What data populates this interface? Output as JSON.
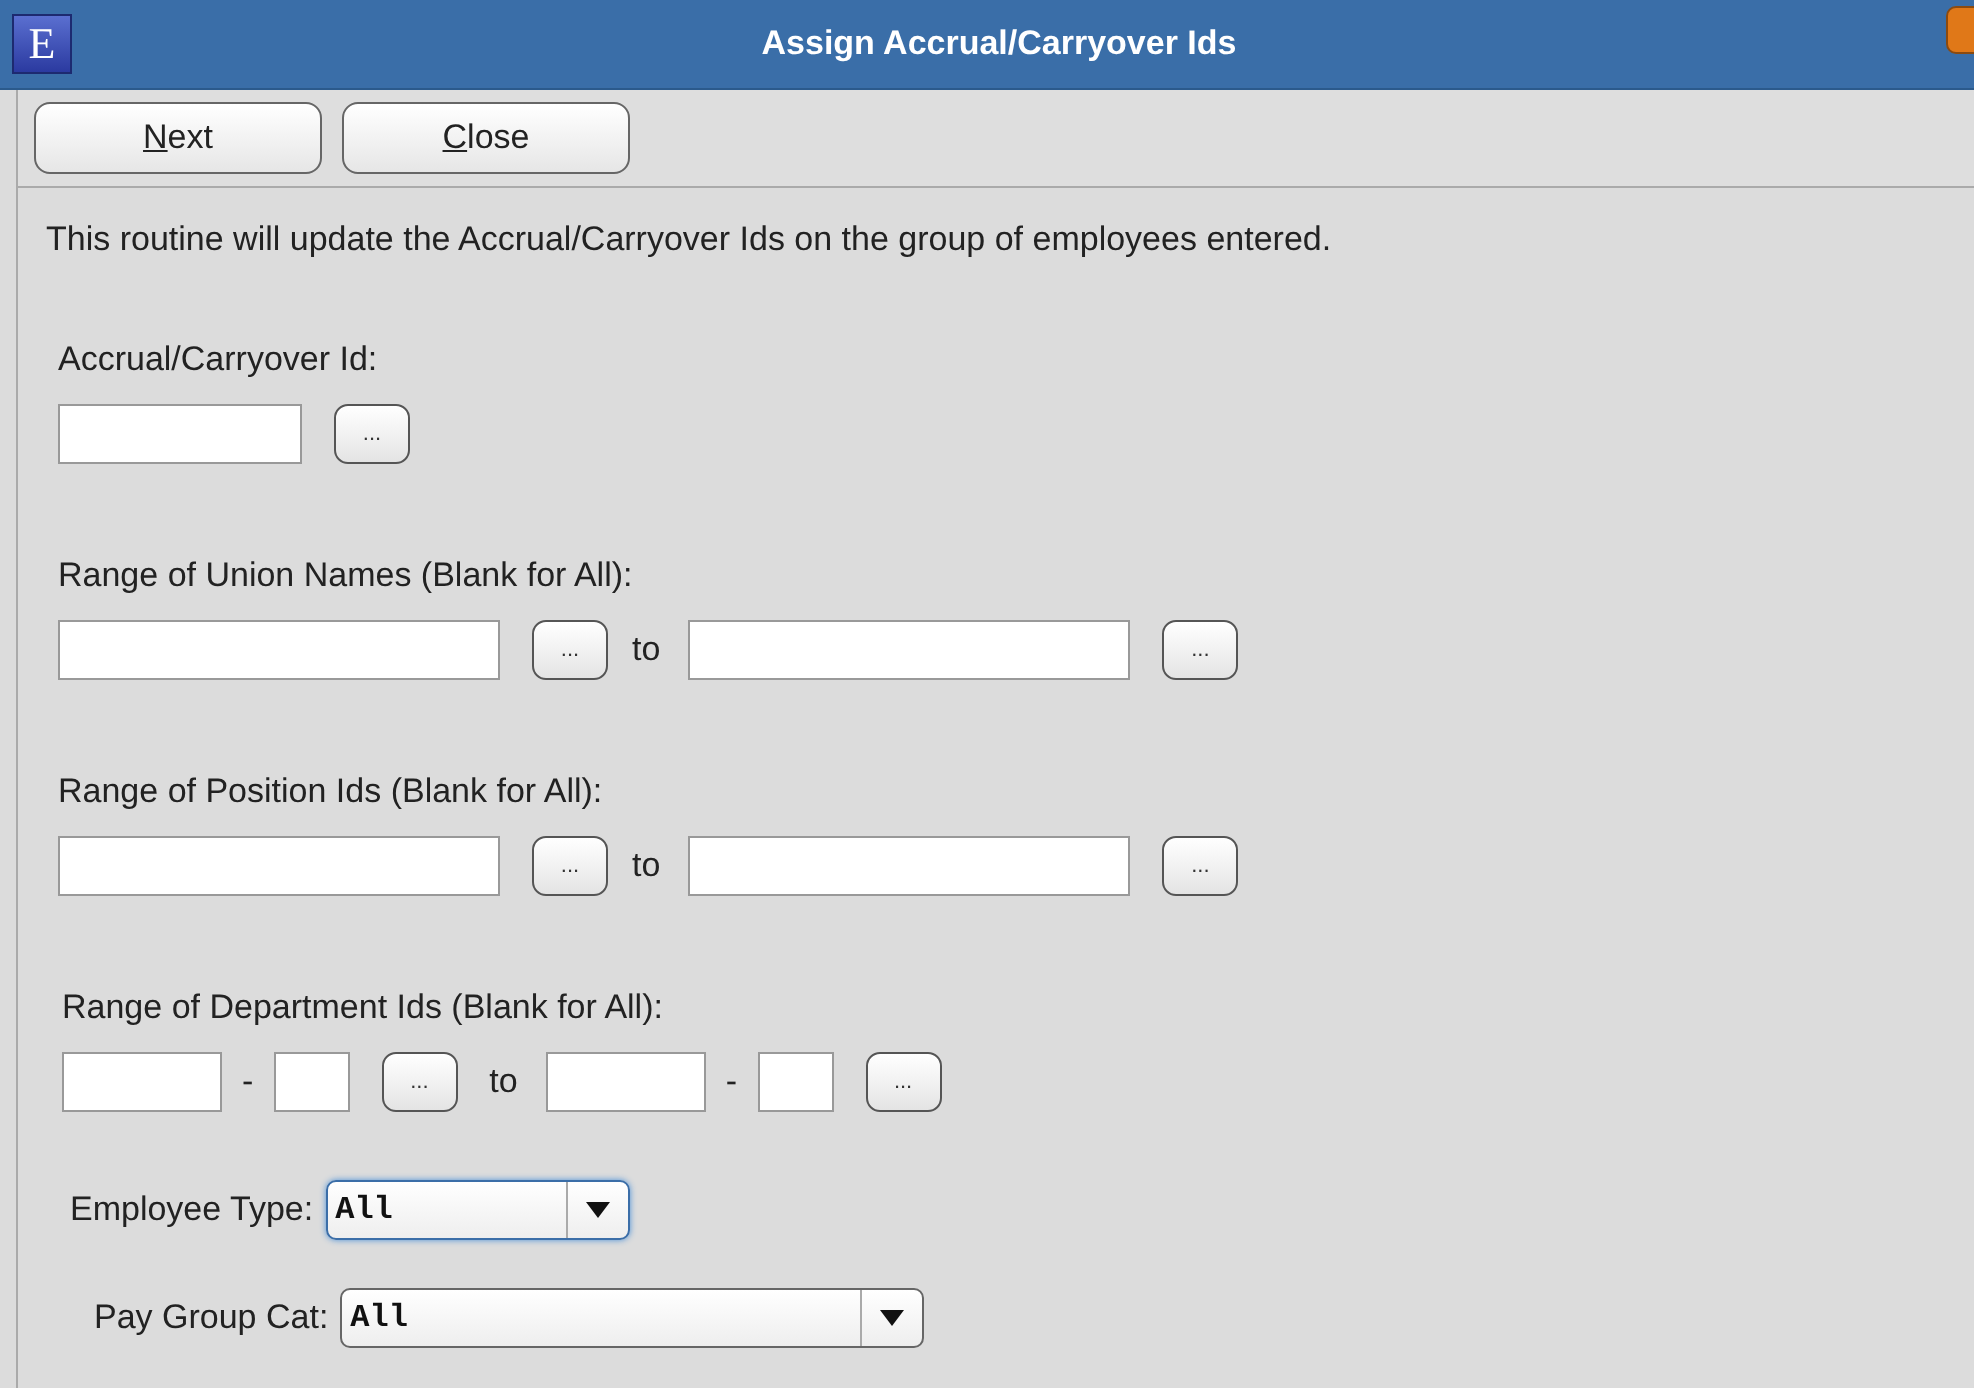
{
  "window": {
    "title": "Assign Accrual/Carryover Ids",
    "app_letter": "E"
  },
  "toolbar": {
    "buttons": [
      "Next",
      "Close"
    ]
  },
  "intro": "This routine will update the Accrual/Carryover Ids on the group of employees entered.",
  "sections": [
    {
      "kind": "single",
      "label": "Accrual/Carryover Id:",
      "lookup": "..."
    },
    {
      "kind": "range",
      "label": "Range of Union Names (Blank for All):",
      "lookup": "...",
      "to": "to"
    },
    {
      "kind": "range",
      "label": "Range of Position Ids (Blank for All):",
      "lookup": "...",
      "to": "to"
    },
    {
      "kind": "split-range",
      "label": "Range of Department Ids (Blank for All):",
      "lookup": "...",
      "to": "to",
      "dash": "-"
    }
  ],
  "selects": [
    {
      "label": "Employee Type:",
      "value": "All",
      "focused": true,
      "wide": false
    },
    {
      "label": "Pay Group Cat:",
      "value": "All",
      "focused": false,
      "wide": true
    }
  ]
}
